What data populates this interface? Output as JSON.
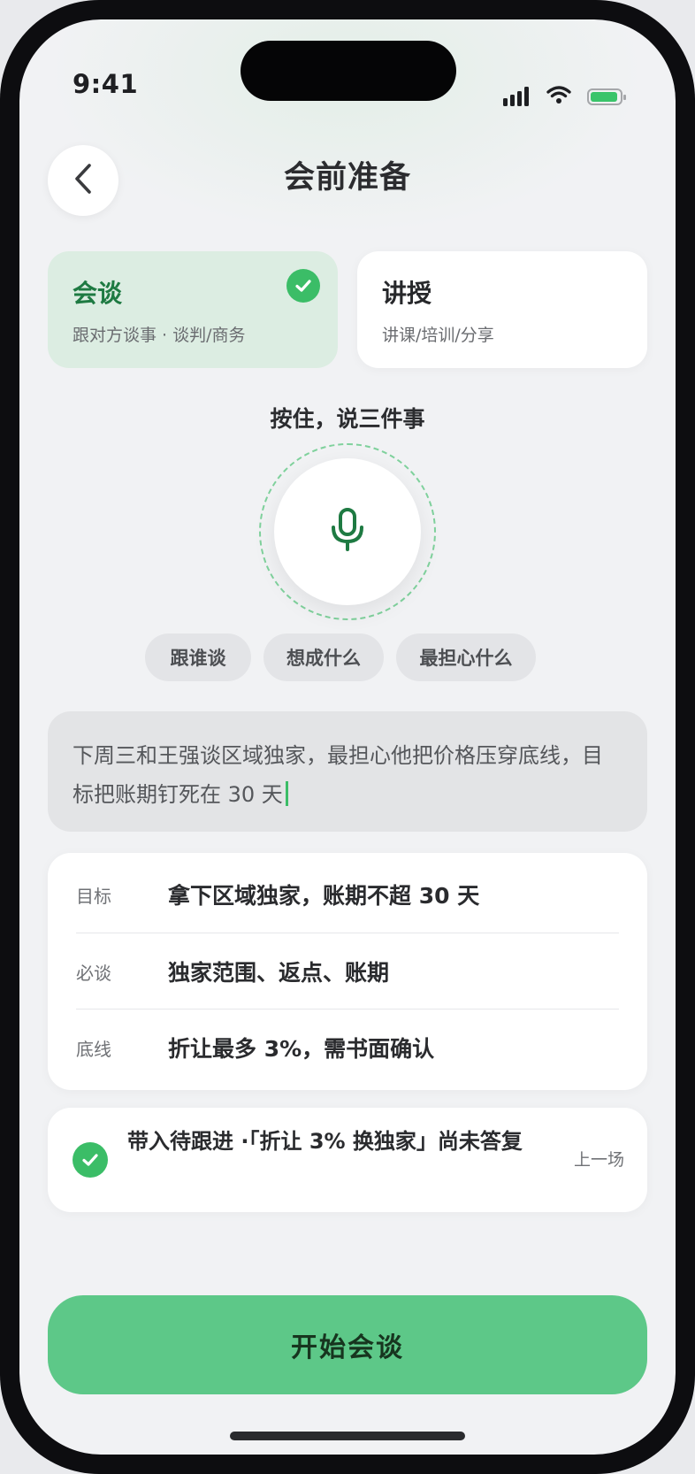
{
  "status_bar": {
    "time": "9:41",
    "icons": [
      "cellular-signal-icon",
      "wifi-icon",
      "battery-icon"
    ],
    "battery_color": "#39c46a"
  },
  "header": {
    "back_icon": "chevron-left-icon",
    "title": "会前准备"
  },
  "modes": [
    {
      "title": "会谈",
      "subtitle": "跟对方谈事 · 谈判/商务",
      "selected": true
    },
    {
      "title": "讲授",
      "subtitle": "讲课/培训/分享",
      "selected": false
    }
  ],
  "voice": {
    "prompt": "按住，说三件事",
    "mic_icon": "microphone-icon",
    "chips": [
      "跟谁谈",
      "想成什么",
      "最担心什么"
    ]
  },
  "transcript": {
    "text": "下周三和王强谈区域独家，最担心他把价格压穿底线，目标把账期钉死在 30 天"
  },
  "plan": {
    "rows": [
      {
        "key": "目标",
        "value": "拿下区域独家，账期不超 30 天"
      },
      {
        "key": "必谈",
        "value": "独家范围、返点、账期"
      },
      {
        "key": "底线",
        "value": "折让最多 3%，需书面确认"
      }
    ]
  },
  "followup": {
    "checked": true,
    "text": "带入待跟进 ·「折让 3% 换独家」尚未答复",
    "source": "上一场"
  },
  "primary_action": {
    "label": "开始会谈"
  },
  "colors": {
    "accent": "#3bbd67",
    "button": "#5dc888",
    "selected_card": "#dcede2"
  }
}
